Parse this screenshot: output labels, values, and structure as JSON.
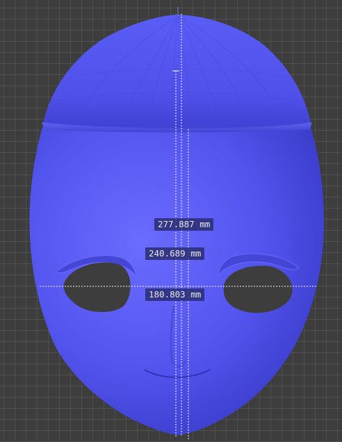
{
  "viewport": {
    "background_color": "#3d3d3d",
    "grid_color": "#4a4a4a",
    "object": {
      "type": "face-mask-mesh",
      "color": "#5355f0",
      "shade_color": "#3a3cc8"
    }
  },
  "measurements": [
    {
      "label": "277.887 mm",
      "axis": "vertical"
    },
    {
      "label": "240.689 mm",
      "axis": "vertical"
    },
    {
      "label": "180.803 mm",
      "axis": "horizontal"
    }
  ]
}
